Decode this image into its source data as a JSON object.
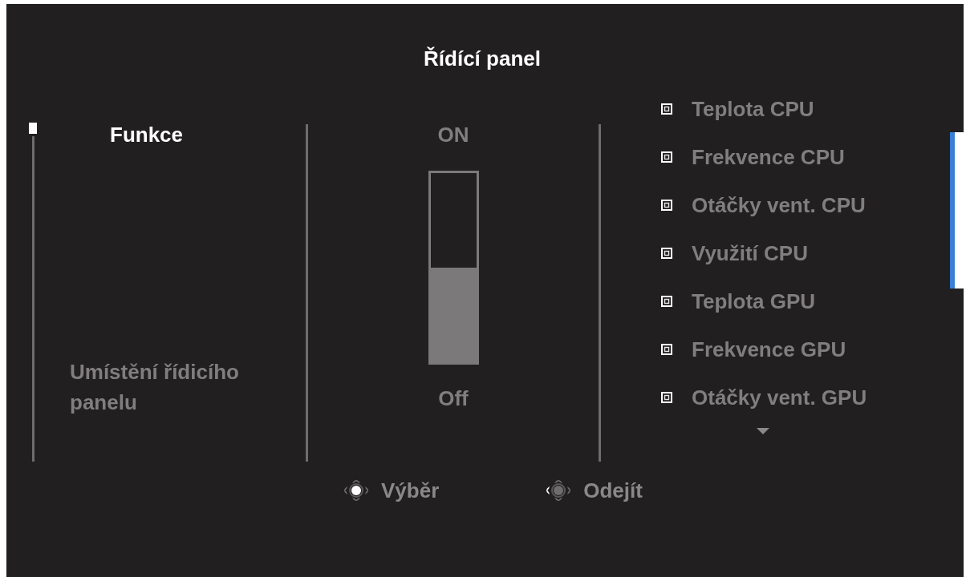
{
  "title": "Řídící panel",
  "menu": {
    "items": [
      {
        "label": "Funkce",
        "selected": true
      },
      {
        "label": "Umístění řídicího panelu",
        "selected": false
      }
    ]
  },
  "switch": {
    "on_label": "ON",
    "off_label": "Off",
    "on": false
  },
  "options": {
    "items": [
      {
        "label": "Teplota CPU",
        "checked": false
      },
      {
        "label": "Frekvence CPU",
        "checked": false
      },
      {
        "label": "Otáčky vent. CPU",
        "checked": false
      },
      {
        "label": "Využití CPU",
        "checked": false
      },
      {
        "label": "Teplota GPU",
        "checked": false
      },
      {
        "label": "Frekvence GPU",
        "checked": false
      },
      {
        "label": "Otáčky vent. GPU",
        "checked": false
      }
    ]
  },
  "hints": [
    {
      "kind": "press",
      "label": "Výběr"
    },
    {
      "kind": "left",
      "label": "Odejít"
    }
  ]
}
